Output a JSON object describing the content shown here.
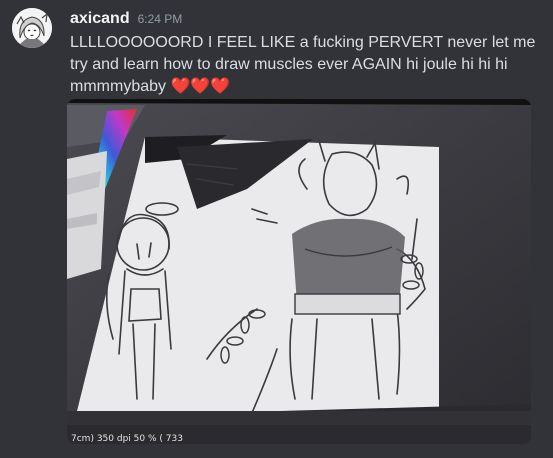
{
  "message": {
    "username": "axicand",
    "timestamp": "6:24 PM",
    "text": "LLLLOOOOOORD I FEEL LIKE a fucking PERVERT never let me try and learn how to draw muscles ever AGAIN hi joule hi hi hi mmmmybaby",
    "emoji": [
      "heart-emoji",
      "heart-emoji",
      "heart-emoji"
    ],
    "heart_color": "#dd2e44"
  },
  "attachment": {
    "photo_status_text": "7cm)  350 dpi  50 % ( 733"
  },
  "colors": {
    "background": "#313338",
    "username": "#f2f3f5",
    "timestamp": "#949ba4",
    "text": "#dbdee1"
  }
}
